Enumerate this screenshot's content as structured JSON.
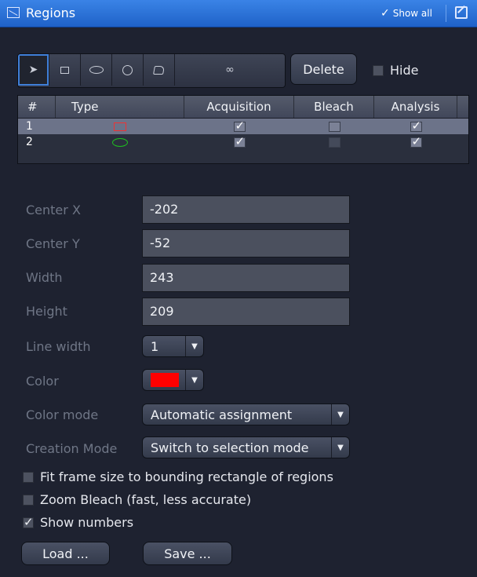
{
  "window": {
    "title": "Regions",
    "show_all": "Show all"
  },
  "toolbar": {
    "tools": [
      "arrow-tool",
      "rectangle-tool",
      "ellipse-tool",
      "circle-tool",
      "polygon-tool",
      "freehand-tool"
    ],
    "delete_label": "Delete",
    "hide_label": "Hide",
    "hide_checked": false
  },
  "table": {
    "headers": [
      "#",
      "Type",
      "Acquisition",
      "Bleach",
      "Analysis"
    ],
    "rows": [
      {
        "num": "1",
        "type": "rectangle",
        "type_color": "#ee3333",
        "acquisition": true,
        "bleach": false,
        "analysis": true
      },
      {
        "num": "2",
        "type": "ellipse",
        "type_color": "#1ec21e",
        "acquisition": true,
        "bleach": false,
        "analysis": true
      }
    ]
  },
  "form": {
    "center_x_label": "Center X",
    "center_x": "-202",
    "center_y_label": "Center Y",
    "center_y": "-52",
    "width_label": "Width",
    "width": "243",
    "height_label": "Height",
    "height": "209",
    "line_width_label": "Line width",
    "line_width": "1",
    "color_label": "Color",
    "color_value": "#ff0000",
    "color_mode_label": "Color mode",
    "color_mode": "Automatic assignment",
    "creation_mode_label": "Creation Mode",
    "creation_mode": "Switch to selection mode"
  },
  "options": {
    "fit_frame": "Fit frame size to bounding rectangle of regions",
    "fit_frame_checked": false,
    "zoom_bleach": "Zoom Bleach (fast, less accurate)",
    "zoom_bleach_checked": false,
    "show_numbers": "Show numbers",
    "show_numbers_checked": true
  },
  "footer": {
    "load_label": "Load ...",
    "save_label": "Save ..."
  }
}
